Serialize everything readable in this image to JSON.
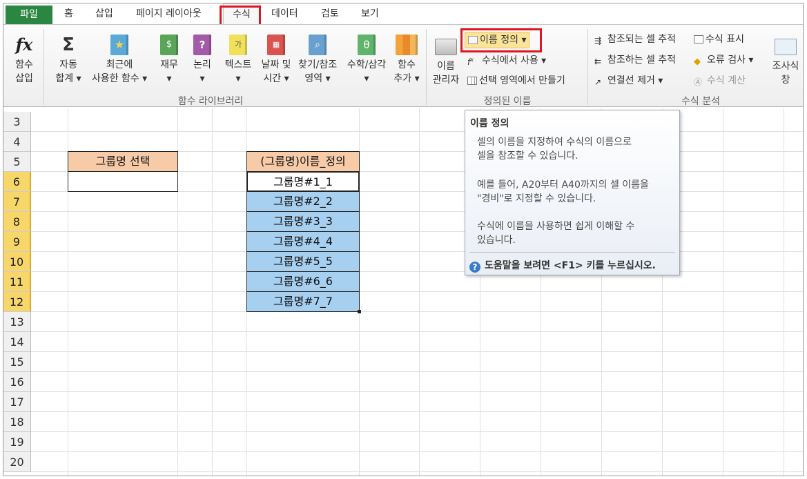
{
  "tabs": [
    "파일",
    "홈",
    "삽입",
    "페이지 레이아웃",
    "수식",
    "데이터",
    "검토",
    "보기"
  ],
  "ribbon": {
    "insert_function": [
      "함수",
      "삽입"
    ],
    "autosum": [
      "자동",
      "합계 ▾"
    ],
    "recent": [
      "최근에",
      "사용한 함수 ▾"
    ],
    "finance": [
      "재무",
      "▾"
    ],
    "logical": [
      "논리",
      "▾"
    ],
    "text": [
      "텍스트",
      "▾"
    ],
    "datetime": [
      "날짜 및",
      "시간 ▾"
    ],
    "lookup": [
      "찾기/참조",
      "영역 ▾"
    ],
    "math": [
      "수학/삼각",
      "▾"
    ],
    "more": [
      "함수",
      "추가 ▾"
    ],
    "group_library": "함수 라이브러리",
    "name_manager": [
      "이름",
      "관리자"
    ],
    "define_name": "이름 정의",
    "use_in_formula": "수식에서 사용 ▾",
    "create_from_selection": "선택 영역에서 만들기",
    "group_defined": "정의된 이름",
    "trace_precedents": "참조되는 셀 추적",
    "trace_dependents": "참조하는 셀 추적",
    "remove_arrows": "연결선 제거 ▾",
    "show_formulas": "수식 표시",
    "error_check": "오류 검사 ▾",
    "evaluate": "수식 계산",
    "watch_window": [
      "조사식",
      "창"
    ],
    "group_audit": "수식 분석"
  },
  "rows": [
    "3",
    "4",
    "5",
    "6",
    "7",
    "8",
    "9",
    "10",
    "11",
    "12",
    "13",
    "14",
    "15",
    "16",
    "17",
    "18",
    "19",
    "20"
  ],
  "cells": {
    "group_select_header": "그룹명 선택",
    "group_select_value": "",
    "define_header": "(그룹명)이름_정의",
    "items": [
      "그룹명#1_1",
      "그룹명#2_2",
      "그룹명#3_3",
      "그룹명#4_4",
      "그룹명#5_5",
      "그룹명#6_6",
      "그룹명#7_7"
    ]
  },
  "tooltip": {
    "title": "이름 정의",
    "para1": [
      "셀의 이름을 지정하여 수식의 이름으로",
      "셀을 참조할 수 있습니다."
    ],
    "para2": [
      "예를 들어, A20부터 A40까지의 셀 이름을",
      "\"경비\"로 지정할 수 있습니다."
    ],
    "para3": [
      "수식에 이름을 사용하면 쉽게 이해할 수",
      "있습니다."
    ],
    "help": "도움말을 보려면 <F1> 키를 누르십시오."
  },
  "colors": {
    "file_tab": "#2a8640",
    "highlight": "#e0141e",
    "peach": "#f8cba8",
    "blue": "#a6cff0",
    "row_selected": "#f8d76a"
  }
}
